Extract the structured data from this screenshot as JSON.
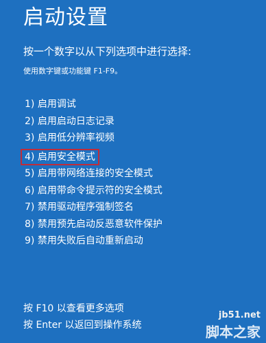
{
  "title": "启动设置",
  "prompt": "按一个数字以从下列选项中进行选择:",
  "hint": "使用数字键或功能键 F1-F9。",
  "options": [
    "1) 启用调试",
    "2) 启用启动日志记录",
    "3) 启用低分辨率视频",
    "4) 启用安全模式",
    "5) 启用带网络连接的安全模式",
    "6) 启用带命令提示符的安全模式",
    "7) 禁用驱动程序强制签名",
    "8) 禁用预先启动反恶意软件保护",
    "9) 禁用失败后自动重新启动"
  ],
  "selected_index": 3,
  "footer": {
    "more_options": "按 F10 以查看更多选项",
    "return": "按 Enter 以返回到操作系统"
  },
  "watermark": {
    "url": "jb51.net",
    "brand": "脚本之家"
  },
  "colors": {
    "background": "#1e70c0",
    "text": "#ffffff",
    "highlight_border": "#c02c3a"
  }
}
